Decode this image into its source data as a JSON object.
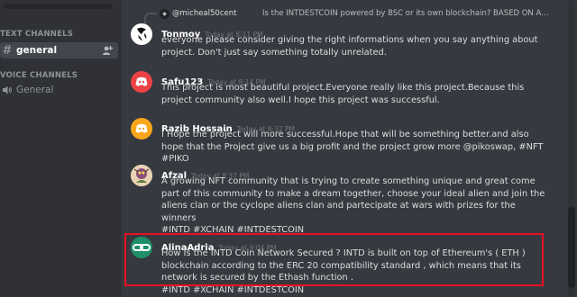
{
  "sidebar": {
    "text_channels_label": "TEXT CHANNELS",
    "voice_channels_label": "VOICE CHANNELS",
    "text_channel": {
      "name": "general",
      "icon": "hash-icon"
    },
    "voice_channel": {
      "name": "General",
      "icon": "speaker-icon"
    }
  },
  "reply": {
    "author": "@micheal50cent",
    "text": "Is the INTDESTCOIN powered by BSC or its own blockchain?     BASED ON A COMPREHENSIVE A..."
  },
  "messages": [
    {
      "author": "Tonmoy",
      "timestamp": "Today at 8:11 PM",
      "text": "everyone please consider giving the right informations when you say anything about project. Don't just say something totally unrelated.",
      "avatar": {
        "type": "logo-dark",
        "bg": "#ffffff"
      }
    },
    {
      "author": "Safu123",
      "timestamp": "Today at 8:14 PM",
      "text": "This project is most beautiful project.Everyone really like this project.Because this project community also well.I hope this project was successful.",
      "avatar": {
        "type": "discord",
        "bg": "#ed4245"
      }
    },
    {
      "author": "Razib Hossain",
      "timestamp": "Today at 8:32 PM",
      "text": "I Hope the project will more successful.Hope that will be something better.and also hope that the Project give us a big profit and the project grow more @pikoswap, #NFT #PIKO",
      "avatar": {
        "type": "discord",
        "bg": "#faa61a"
      }
    },
    {
      "author": "Afzal",
      "timestamp": "Today at 8:37 PM",
      "text": "A growing NFT community that is trying to create something unique and great come part of this community to make a dream together, choose your ideal alien and join the aliens clan or the cyclope aliens clan and partecipate at wars with prizes for the winners",
      "tags": "#INTD #XCHAIN  #INTDESTCOIN",
      "avatar": {
        "type": "art",
        "bg": "#c9a27e"
      }
    },
    {
      "author": "AlinaAdria",
      "timestamp": "Today at 9:04 PM",
      "text": "How Is the INTD Coin Network Secured ? INTD is built on top of Ethereum's ( ETH ) blockchain according to the ERC 20 compatibility standard , which means that its network is secured by the Ethash function .",
      "tags": "#INTD #XCHAIN #INTDESTCOIN",
      "avatar": {
        "type": "link",
        "bg": "#1f8f6a"
      }
    }
  ],
  "colors": {
    "highlight": "#e81123",
    "background": "#36393f",
    "sidebar": "#2f3136"
  }
}
